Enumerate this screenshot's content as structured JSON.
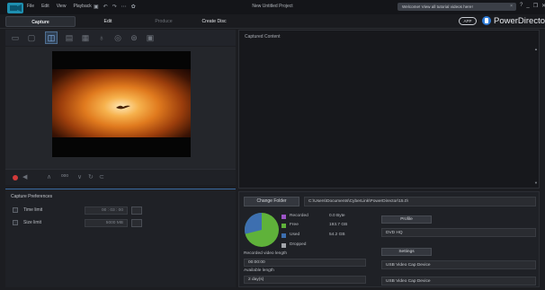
{
  "titlebar": {
    "menu": [
      "File",
      "Edit",
      "View",
      "Playback"
    ],
    "project_title": "New Untitled Project",
    "welcome": "Welcome! View all tutorial videos here!",
    "close": "×",
    "window_controls": [
      "?",
      "_",
      "❐",
      "✕"
    ]
  },
  "tabs": {
    "capture": "Capture",
    "edit": "Edit",
    "produce": "Produce",
    "create_disc": "Create Disc"
  },
  "brand": {
    "app_pill": "APP",
    "name": "PowerDirector",
    "accent": "#2f7bd7"
  },
  "capture_toolbar": {
    "icons": [
      "optical-drive-icon",
      "camcorder-icon",
      "webcam-icon",
      "tv-icon",
      "dv-icon",
      "microphone-icon",
      "radio-icon",
      "screen-capture-icon",
      "record-screen-icon"
    ],
    "active_index": 2
  },
  "playback": {
    "time": "000"
  },
  "captured": {
    "header": "Captured Content"
  },
  "prefs": {
    "header": "Capture Preferences",
    "time_limit_label": "Time limit",
    "time_limit_value": "00 : 03 : 00",
    "size_limit_label": "Size limit",
    "size_limit_value": "5000   MB"
  },
  "panel": {
    "change_folder": "Change Folder",
    "folder_path": "C:\\Users\\Documents\\CyberLink\\PowerDirector\\15.0\\",
    "legend": [
      {
        "label": "Recorded",
        "value": "0.0  Byte",
        "color": "#9c54c6"
      },
      {
        "label": "Free",
        "value": "193.7  GB",
        "color": "#5fb23a"
      },
      {
        "label": "Used",
        "value": "54.2  GB",
        "color": "#3d6fb0"
      },
      {
        "label": "Dropped",
        "value": "",
        "color": "#a3a6ab"
      }
    ],
    "recorded_length_label": "Recorded video length",
    "recorded_length_value": "00:00:00",
    "available_length_label": "Available length",
    "available_length_value": "2 day(s)",
    "profile_button": "Profile",
    "profile_value": "DVD HQ",
    "settings_button": "Settings",
    "device_1": "USB Video Cap Device",
    "device_2": "USB Video Cap Device"
  }
}
